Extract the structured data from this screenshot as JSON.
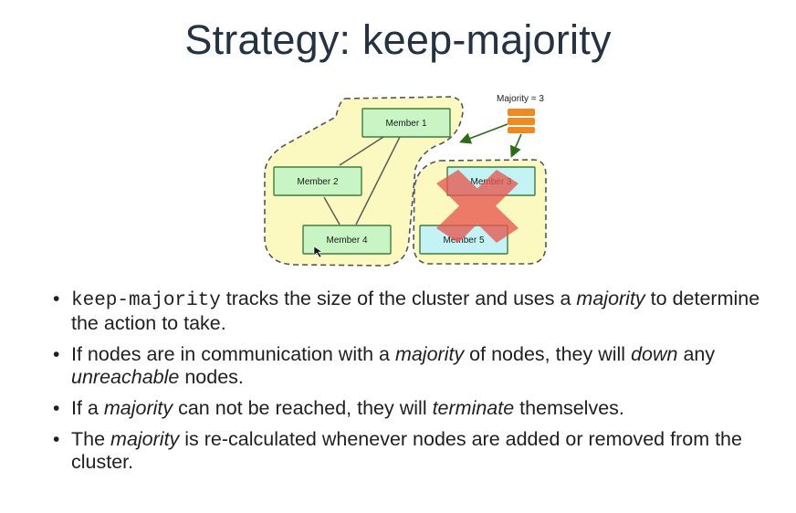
{
  "title": "Strategy: keep-majority",
  "diagram": {
    "majority_label": "Majority = 3",
    "members": {
      "m1": "Member 1",
      "m2": "Member 2",
      "m3": "Member 3",
      "m4": "Member 4",
      "m5": "Member 5"
    },
    "colors": {
      "majority_region": "#fbf9bf",
      "node_green": "#c9f5c5",
      "node_cyan": "#c3f3f5",
      "node_border": "#3d7d42",
      "cross": "#e7574f",
      "arrow": "#2d6b1b",
      "db_icon": "#f08a1e"
    },
    "icons": {
      "majority_marker": "database-icon",
      "down_marker": "cross-icon"
    }
  },
  "bullets": [
    {
      "code": "keep-majority",
      "text1": " tracks the size of the cluster and uses a ",
      "em1": "majority",
      "text2": " to determine the action to take."
    },
    {
      "text1": "If nodes are in communication with a ",
      "em1": "majority",
      "text2": " of nodes, they will ",
      "em2": "down",
      "text3": " any ",
      "em3": "unreachable",
      "text4": " nodes."
    },
    {
      "text1": "If a ",
      "em1": "majority",
      "text2": " can not be reached, they will ",
      "em2": "terminate",
      "text3": " themselves."
    },
    {
      "text1": "The ",
      "em1": "majority",
      "text2": " is re-calculated whenever nodes are added or removed from the cluster."
    }
  ]
}
